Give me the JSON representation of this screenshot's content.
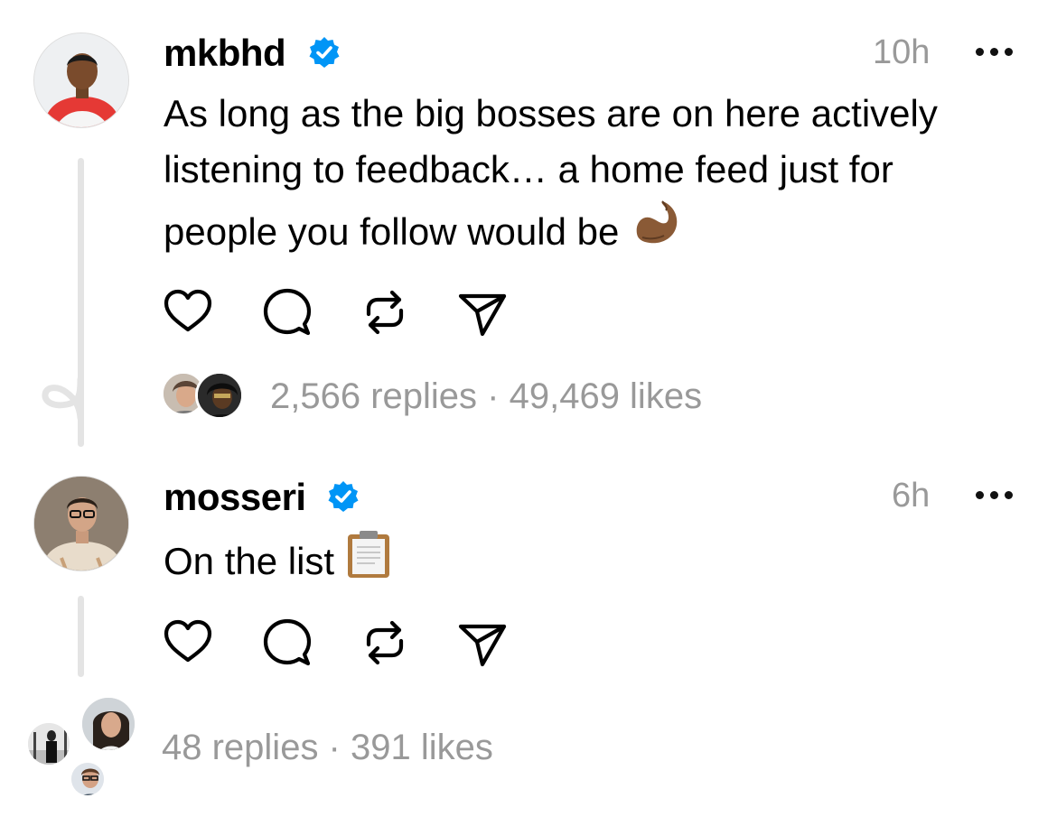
{
  "posts": [
    {
      "username": "mkbhd",
      "time": "10h",
      "text_lines": [
        "As long as the big bosses are on here actively",
        "listening to feedback… a home feed just for",
        "people you follow would be"
      ],
      "emoji_icon": "pinched-fingers-emoji",
      "stats": "2,566 replies · 49,469 likes"
    },
    {
      "username": "mosseri",
      "time": "6h",
      "text": "On the list",
      "emoji_icon": "clipboard-emoji",
      "stats": "48 replies · 391 likes"
    }
  ],
  "icons": {
    "verified": "verified-badge-icon",
    "like": "heart-icon",
    "reply": "comment-icon",
    "repost": "repost-icon",
    "share": "send-icon",
    "more": "more-options-icon"
  },
  "colors": {
    "verified_blue": "#0095f6",
    "muted_text": "#999999",
    "thread_line": "#e4e4e4"
  }
}
